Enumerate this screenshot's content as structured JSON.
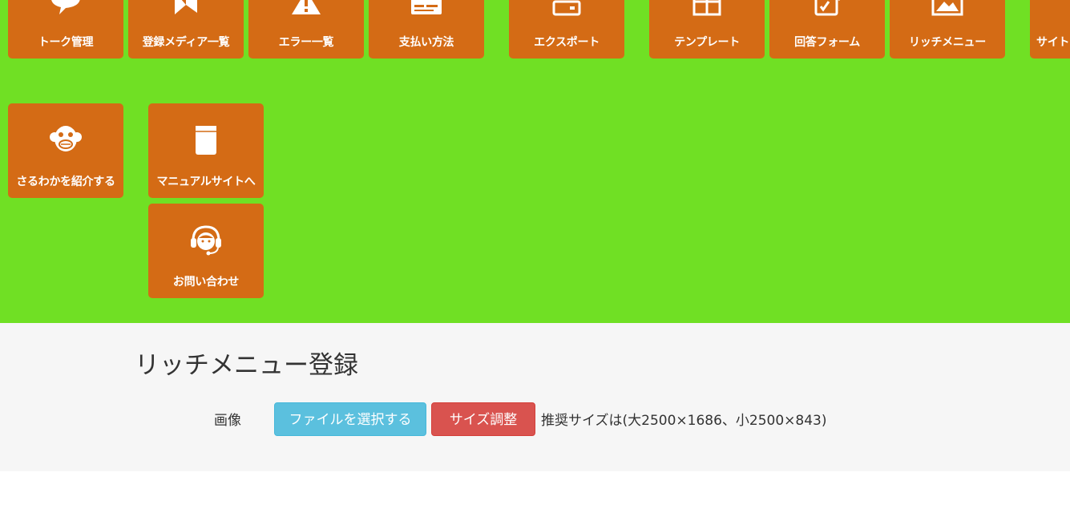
{
  "nav_tiles": [
    {
      "label": "トーク管理",
      "icon": "chat-bubble-icon"
    },
    {
      "label": "登録メディア一覧",
      "icon": "media-icon"
    },
    {
      "label": "エラー一覧",
      "icon": "warning-icon"
    },
    {
      "label": "支払い方法",
      "icon": "credit-card-icon"
    },
    {
      "label": "エクスポート",
      "icon": "export-icon"
    },
    {
      "label": "テンプレート",
      "icon": "template-icon"
    },
    {
      "label": "回答フォーム",
      "icon": "form-edit-icon"
    },
    {
      "label": "リッチメニュー",
      "icon": "image-icon"
    },
    {
      "label": "サイト",
      "icon": "site-icon"
    },
    {
      "label": "さるわかを紹介する",
      "icon": "monkey-icon"
    },
    {
      "label": "マニュアルサイトへ",
      "icon": "book-icon"
    },
    {
      "label": "お問い合わせ",
      "icon": "headset-icon"
    }
  ],
  "page": {
    "title": "リッチメニュー登録"
  },
  "form": {
    "image_label": "画像",
    "file_button_label": "ファイルを選択する",
    "resize_button_label": "サイズ調整",
    "size_hint": "推奨サイズは(大2500×1686、小2500×843)"
  },
  "colors": {
    "header_background": "#70e024",
    "tile_background": "#d46b15",
    "file_button": "#5bc0de",
    "resize_button": "#d9534f",
    "content_background": "#f6f6f6"
  }
}
